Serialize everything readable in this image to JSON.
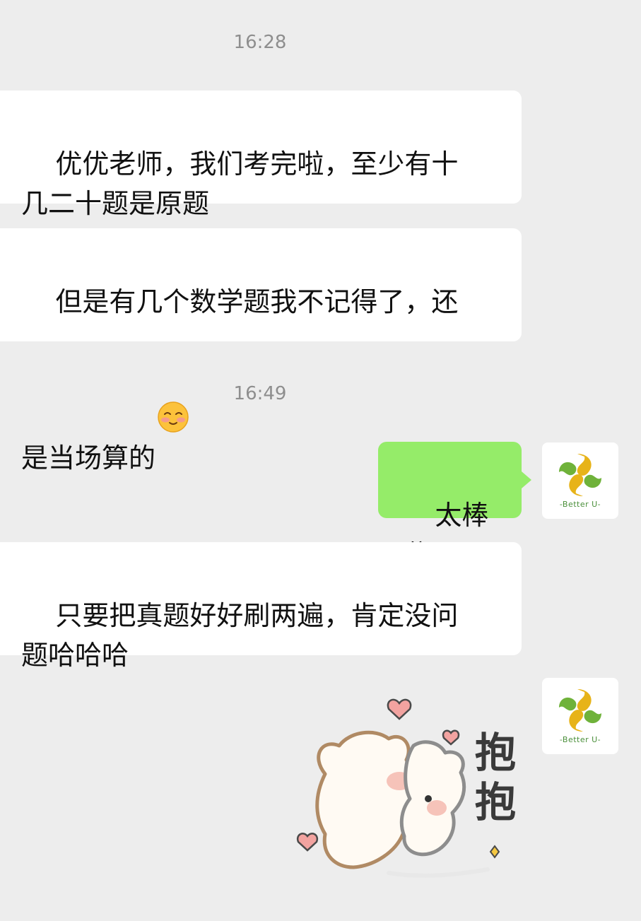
{
  "messages": {
    "time1": "16:28",
    "msg1": "优优老师，我们考完啦，至少有十\n几二十题是原题",
    "msg2": "但是有几个数学题我不记得了，还\n是当场算的",
    "time2": "16:49",
    "msg3": "太棒啦",
    "msg4": "只要把真题好好刷两遍，肯定没问\n题哈哈哈"
  },
  "avatar": {
    "logo_text": "-Better U-"
  },
  "sticker": {
    "text_line1": "抱",
    "text_line2": "抱"
  },
  "colors": {
    "background": "#ededed",
    "incoming_bubble": "#ffffff",
    "outgoing_bubble": "#95ec69",
    "timestamp": "#8e8e8e"
  }
}
